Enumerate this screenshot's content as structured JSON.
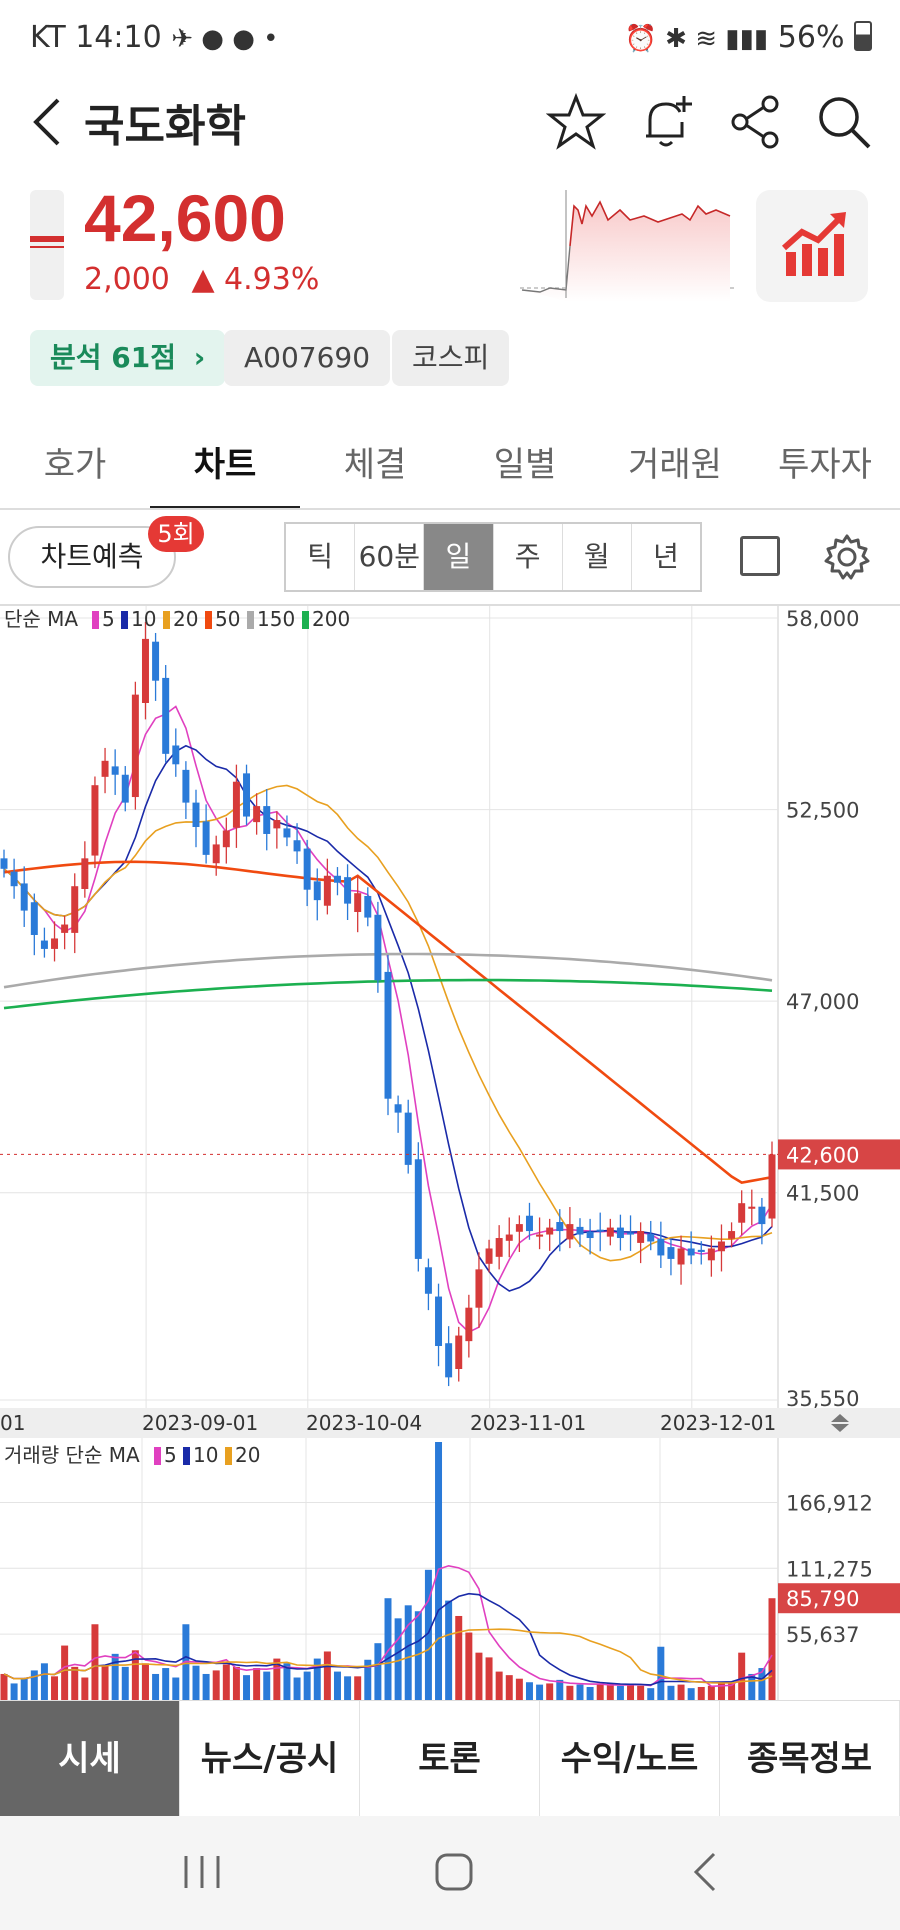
{
  "status_bar": {
    "carrier": "KT",
    "time": "14:10",
    "battery": "56%"
  },
  "header": {
    "title": "국도화학"
  },
  "quote": {
    "price": "42,600",
    "change": "2,000",
    "change_pct": "▲ 4.93%",
    "up_color": "#d32f2f"
  },
  "tags": {
    "analysis": "분석 61점",
    "code": "A007690",
    "market": "코스피"
  },
  "tabs": [
    "호가",
    "차트",
    "체결",
    "일별",
    "거래원",
    "투자자"
  ],
  "active_tab": "차트",
  "toolbar": {
    "predict_label": "차트예측",
    "predict_badge": "5회",
    "periods": [
      "틱",
      "60분",
      "일",
      "주",
      "월",
      "년"
    ],
    "active_period": "일"
  },
  "chart_data": [
    {
      "type": "candlestick",
      "legend_prefix": "단순 MA",
      "ma_legend": [
        {
          "name": "5",
          "color": "#e040c0"
        },
        {
          "name": "10",
          "color": "#1a2aa8"
        },
        {
          "name": "20",
          "color": "#e8a020"
        },
        {
          "name": "50",
          "color": "#f04a10"
        },
        {
          "name": "150",
          "color": "#aaaaaa"
        },
        {
          "name": "200",
          "color": "#1cb050"
        }
      ],
      "y_ticks": [
        "58,000",
        "52,500",
        "47,000",
        "41,500",
        "35,550"
      ],
      "current_price_label": "42,600",
      "x_ticks": [
        "01",
        "2023-09-01",
        "2023-10-04",
        "2023-11-01",
        "2023-12-01"
      ],
      "ylim": [
        35550,
        58000
      ],
      "close_series": [
        50800,
        50300,
        49600,
        48900,
        48500,
        48800,
        49200,
        50300,
        51100,
        53200,
        53900,
        53500,
        52700,
        55800,
        57400,
        56200,
        54100,
        53800,
        52700,
        52000,
        51200,
        51500,
        51900,
        53300,
        52300,
        52600,
        51800,
        52200,
        51700,
        51300,
        50200,
        49900,
        50600,
        50400,
        49800,
        50100,
        49400,
        47600,
        44200,
        43800,
        42300,
        39600,
        38600,
        37100,
        36200,
        37400,
        38200,
        39300,
        39900,
        40200,
        40300,
        40600,
        40400,
        40300,
        40500,
        40400,
        40600,
        40300,
        40200,
        40400,
        40500,
        40200,
        40300,
        40400,
        40100,
        39700,
        39600,
        39900,
        39700,
        39800,
        39900,
        40100,
        40400,
        41200,
        41100,
        40600,
        42600
      ]
    },
    {
      "type": "bar",
      "legend_prefix": "거래량 단순 MA",
      "ma_legend": [
        {
          "name": "5",
          "color": "#e040c0"
        },
        {
          "name": "10",
          "color": "#1a2aa8"
        },
        {
          "name": "20",
          "color": "#e8a020"
        }
      ],
      "y_ticks": [
        "166,912",
        "111,275",
        "55,637"
      ],
      "current_volume_label": "85,790",
      "volume_series": [
        22000,
        14000,
        18000,
        25000,
        31000,
        20000,
        46000,
        28000,
        19000,
        64000,
        29000,
        39000,
        28000,
        42000,
        31000,
        22000,
        27000,
        19000,
        64000,
        29000,
        22000,
        25000,
        30000,
        28000,
        21000,
        27000,
        24000,
        35000,
        31000,
        19000,
        24000,
        35000,
        41000,
        24000,
        20000,
        20000,
        34000,
        48000,
        86000,
        69000,
        80000,
        75000,
        110000,
        218000,
        84000,
        71000,
        57000,
        40000,
        36000,
        24000,
        21000,
        18000,
        15000,
        13000,
        14000,
        17000,
        12000,
        13000,
        11000,
        14000,
        14000,
        12000,
        13000,
        12000,
        10000,
        45000,
        12000,
        13000,
        10000,
        11000,
        12000,
        14000,
        15000,
        40000,
        22000,
        27000,
        86000
      ]
    }
  ],
  "bottom_nav": [
    "시세",
    "뉴스/공시",
    "토론",
    "수익/노트",
    "종목정보"
  ],
  "active_bottom": "시세"
}
